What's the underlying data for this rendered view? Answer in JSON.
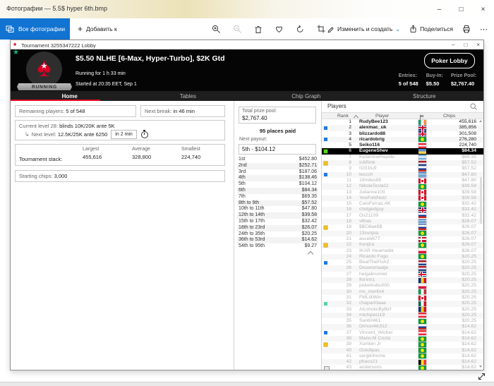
{
  "icons": {
    "minimize": "–",
    "maximize": "□",
    "close": "×",
    "plus": "+",
    "chevron_down": "⌄",
    "ellipsis": "⋯",
    "spade": "♠",
    "star": "★",
    "branch_arrow": "↳"
  },
  "app": {
    "title": "Фотографии — 5.5$ hyper 6th.bmp",
    "toolbar": {
      "all_photos": "Все фотографии",
      "add_to": "Добавить к",
      "edit_create": "Изменить и создать",
      "share": "Поделиться"
    }
  },
  "poker": {
    "window_title": "Tournament 3255347222 Lobby",
    "header": {
      "status": "RUNNING",
      "title": "$5.50 NLHE [6-Max, Hyper-Turbo], $2K Gtd",
      "running_for": "Running for 1 h 33 min",
      "started": "Started at 20:35 EET, Sep 1",
      "lobby_button": "Poker Lobby",
      "entries_label": "Entries:",
      "entries_value": "5 of 548",
      "buyin_label": "Buy-In:",
      "buyin_value": "$5.50",
      "prizepool_label": "Prize Pool:",
      "prizepool_value": "$2,767.40"
    },
    "tabs": [
      {
        "label": "Home",
        "state": "active"
      },
      {
        "label": "Tables",
        "state": "idle"
      },
      {
        "label": "Chip Graph",
        "state": "idle"
      },
      {
        "label": "Structure",
        "state": "idle"
      }
    ],
    "home": {
      "remaining_label": "Remaining players:",
      "remaining_value": "5 of 548",
      "break_label": "Next break:",
      "break_value": "in 46 min",
      "level_label": "Current level 28:",
      "level_value": "blinds 10K/20K ante 5K",
      "next_level_label": "Next level:",
      "next_level_value": "12.5K/25K ante 6250",
      "next_level_in": "in 2 min",
      "stack_label": "Tournament stack:",
      "stack_cols": [
        {
          "label": "Largest",
          "value": "455,616"
        },
        {
          "label": "Average",
          "value": "328,800"
        },
        {
          "label": "Smallest",
          "value": "224,740"
        }
      ],
      "starting_label": "Starting chips:",
      "starting_value": "3,000"
    },
    "payouts": {
      "total_label": "Total prize pool:",
      "total_value": "$2,767.40",
      "places_paid": "95 places paid",
      "next_label": "Next payout:",
      "next_value": "5th - $104.12",
      "rows": [
        {
          "place": "1st",
          "amount": "$452.80"
        },
        {
          "place": "2nd",
          "amount": "$252.71"
        },
        {
          "place": "3rd",
          "amount": "$187.06"
        },
        {
          "place": "4th",
          "amount": "$138.46"
        },
        {
          "place": "5th",
          "amount": "$104.12"
        },
        {
          "place": "6th",
          "amount": "$84.34"
        },
        {
          "place": "7th",
          "amount": "$69.35"
        },
        {
          "place": "8th to 9th",
          "amount": "$57.52"
        },
        {
          "place": "10th to 11th",
          "amount": "$47.80"
        },
        {
          "place": "12th to 14th",
          "amount": "$39.58"
        },
        {
          "place": "15th to 17th",
          "amount": "$32.42"
        },
        {
          "place": "18th to 23rd",
          "amount": "$26.07"
        },
        {
          "place": "24th to 35th",
          "amount": "$20.25"
        },
        {
          "place": "36th to 53rd",
          "amount": "$14.62"
        },
        {
          "place": "54th to 95th",
          "amount": "$9.27"
        }
      ]
    },
    "players_panel": {
      "title": "Players",
      "col_rank": "Rank",
      "col_player": "Player",
      "col_chips": "Chips",
      "players": [
        {
          "rank": "1",
          "name": "RudyBee123",
          "flag": "ireland",
          "chips": "455,616",
          "marker": "",
          "state": "active"
        },
        {
          "rank": "2",
          "name": "alexmac_uk",
          "flag": "uk",
          "chips": "385,856",
          "marker": "blue",
          "state": "active"
        },
        {
          "rank": "3",
          "name": "blizzardo88",
          "flag": "uk",
          "chips": "301,508",
          "marker": "",
          "state": "active"
        },
        {
          "rank": "4",
          "name": "ricardobrig",
          "flag": "brazil",
          "chips": "276,280",
          "marker": "blue",
          "state": "active"
        },
        {
          "rank": "5",
          "name": "Seiko116",
          "flag": "austria",
          "chips": "224,740",
          "marker": "",
          "state": "active"
        },
        {
          "rank": "6",
          "name": "EugeneShev",
          "flag": "ukraine",
          "chips": "$84.34",
          "marker": "green",
          "state": "selected"
        },
        {
          "rank": "7",
          "name": "KetamineReptile",
          "flag": "argentina",
          "chips": "$69.35",
          "marker": "",
          "state": "out"
        },
        {
          "rank": "8",
          "name": "Ic6Rink",
          "flag": "netherlands",
          "chips": "$57.52",
          "marker": "yellow",
          "state": "out"
        },
        {
          "rank": "9",
          "name": "I1t31tu9",
          "flag": "russia",
          "chips": "$57.52",
          "marker": "",
          "state": "out"
        },
        {
          "rank": "10",
          "name": "teccch",
          "flag": "greece",
          "chips": "$47.80",
          "marker": "blue",
          "state": "out"
        },
        {
          "rank": "11",
          "name": "19miles88",
          "flag": "canada",
          "chips": "$47.80",
          "marker": "",
          "state": "out"
        },
        {
          "rank": "12",
          "name": "NikolaTesla11",
          "flag": "brazil",
          "chips": "$39.58",
          "marker": "",
          "state": "out"
        },
        {
          "rank": "13",
          "name": "Julianne100",
          "flag": "canada",
          "chips": "$39.58",
          "marker": "",
          "state": "out"
        },
        {
          "rank": "14",
          "name": "YouFoldNutz",
          "flag": "canada",
          "chips": "$39.58",
          "marker": "",
          "state": "out"
        },
        {
          "rank": "15",
          "name": "CaioFerraz.AK",
          "flag": "brazil",
          "chips": "$32.42",
          "marker": "",
          "state": "out"
        },
        {
          "rank": "16",
          "name": "chidgedguy",
          "flag": "uk",
          "chips": "$32.42",
          "marker": "",
          "state": "out"
        },
        {
          "rank": "17",
          "name": "Os21109",
          "flag": "russia",
          "chips": "$32.42",
          "marker": "",
          "state": "out"
        },
        {
          "rank": "18",
          "name": "vlihas",
          "flag": "greece",
          "chips": "$26.07",
          "marker": "",
          "state": "out"
        },
        {
          "rank": "19",
          "name": "$$Ci6ak$$",
          "flag": "russia",
          "chips": "$26.07",
          "marker": "yellow",
          "state": "out"
        },
        {
          "rank": "20",
          "name": "13svnjoa",
          "flag": "brazil",
          "chips": "$26.07",
          "marker": "",
          "state": "out"
        },
        {
          "rank": "21",
          "name": "asseb677",
          "flag": "denmark",
          "chips": "$26.07",
          "marker": "",
          "state": "out"
        },
        {
          "rank": "22",
          "name": "Kenjira",
          "flag": "brazil",
          "chips": "$26.07",
          "marker": "yellow",
          "state": "out"
        },
        {
          "rank": "23",
          "name": "IKAR #teamwbk",
          "flag": "poland",
          "chips": "$26.07",
          "marker": "",
          "state": "out"
        },
        {
          "rank": "24",
          "name": "Ricardo Fogo",
          "flag": "brazil",
          "chips": "$20.25",
          "marker": "",
          "state": "out"
        },
        {
          "rank": "25",
          "name": "BeatTheFish2",
          "flag": "netherlands",
          "chips": "$20.25",
          "marker": "blue",
          "state": "out"
        },
        {
          "rank": "26",
          "name": "Douwsmaatje",
          "flag": "netherlands",
          "chips": "$20.25",
          "marker": "",
          "state": "out"
        },
        {
          "rank": "27",
          "name": "helgabrunner",
          "flag": "iceland",
          "chips": "$20.25",
          "marker": "",
          "state": "out"
        },
        {
          "rank": "28",
          "name": "florinn1",
          "flag": "romania",
          "chips": "$20.25",
          "marker": "",
          "state": "out"
        },
        {
          "rank": "29",
          "name": "pokerkubu000",
          "flag": "poland",
          "chips": "$20.25",
          "marker": "",
          "state": "out"
        },
        {
          "rank": "30",
          "name": "mc_merlin4",
          "flag": "italy",
          "chips": "$20.25",
          "marker": "",
          "state": "out"
        },
        {
          "rank": "31",
          "name": "FMLtiliWin",
          "flag": "canada",
          "chips": "$20.25",
          "marker": "",
          "state": "out"
        },
        {
          "rank": "32",
          "name": "chaparritaaa",
          "flag": "mexico",
          "chips": "$20.25",
          "marker": "mint",
          "state": "out"
        },
        {
          "rank": "33",
          "name": "AlcoholicByBirf",
          "flag": "romania",
          "chips": "$20.25",
          "marker": "",
          "state": "out"
        },
        {
          "rank": "34",
          "name": "michipet119",
          "flag": "austria",
          "chips": "$20.25",
          "marker": "",
          "state": "out"
        },
        {
          "rank": "35",
          "name": "Santii!461",
          "flag": "brazil",
          "chips": "$20.25",
          "marker": "",
          "state": "out"
        },
        {
          "rank": "36",
          "name": "Dimon4ik312",
          "flag": "russia",
          "chips": "$14.62",
          "marker": "",
          "state": "out"
        },
        {
          "rank": "37",
          "name": "Vincent_Wicher",
          "flag": "austria",
          "chips": "$14.62",
          "marker": "blue",
          "state": "out"
        },
        {
          "rank": "38",
          "name": "Manu M Costa",
          "flag": "brazil",
          "chips": "$14.62",
          "marker": "",
          "state": "out"
        },
        {
          "rank": "39",
          "name": "Xumbin Jr",
          "flag": "brazil",
          "chips": "$14.62",
          "marker": "yellow",
          "state": "out"
        },
        {
          "rank": "40",
          "name": "Gutolipas",
          "flag": "brazil",
          "chips": "$14.62",
          "marker": "",
          "state": "out"
        },
        {
          "rank": "41",
          "name": "sergiinhome",
          "flag": "brazil",
          "chips": "$14.62",
          "marker": "",
          "state": "out"
        },
        {
          "rank": "42",
          "name": "phaco21",
          "flag": "belgium",
          "chips": "$14.62",
          "marker": "",
          "state": "out"
        },
        {
          "rank": "43",
          "name": "andersons",
          "flag": "brazil",
          "chips": "$14.62",
          "marker": "monitor",
          "state": "out"
        }
      ]
    }
  }
}
